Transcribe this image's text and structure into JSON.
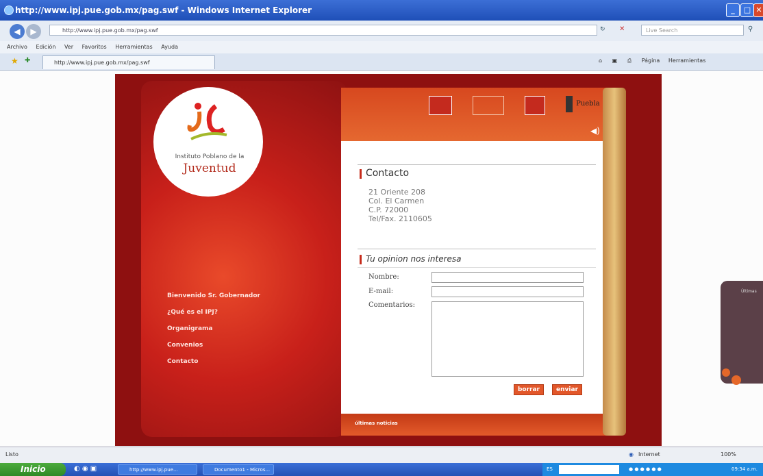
{
  "browser": {
    "title": "http://www.ipj.pue.gob.mx/pag.swf - Windows Internet Explorer",
    "address": "http://www.ipj.pue.gob.mx/pag.swf",
    "search_placeholder": "Live Search",
    "menu": [
      "Archivo",
      "Edición",
      "Ver",
      "Favoritos",
      "Herramientas",
      "Ayuda"
    ],
    "tab_label": "http://www.ipj.pue.gob.mx/pag.swf",
    "toolbar_page": "Página",
    "toolbar_tools": "Herramientas",
    "status_left": "Listo",
    "status_zone": "Internet",
    "zoom": "100%"
  },
  "site": {
    "logo_line1": "Instituto Poblano de la",
    "logo_line2": "Juventud",
    "nav": [
      "Bienvenido Sr. Gobernador",
      "¿Qué es el IPJ?",
      "Organigrama",
      "Convenios",
      "Contacto"
    ],
    "header_logos": [
      "Puebla"
    ],
    "contact": {
      "heading": "Contacto",
      "address": [
        "21 Oriente 208",
        "Col. El Carmen",
        "C.P. 72000",
        "Tel/Fax. 2110605"
      ]
    },
    "form": {
      "heading": "Tu opinion nos interesa",
      "name_label": "Nombre:",
      "email_label": "E-mail:",
      "comments_label": "Comentarios:",
      "clear_button": "borrar",
      "send_button": "enviar"
    },
    "footer": "últimas noticias",
    "side_label": "Últimas"
  },
  "taskbar": {
    "start": "Inicio",
    "tasks": [
      "http://www.ipj.pue...",
      "Documento1 - Micros..."
    ],
    "lang": "ES",
    "clock": "09:34 a.m."
  }
}
